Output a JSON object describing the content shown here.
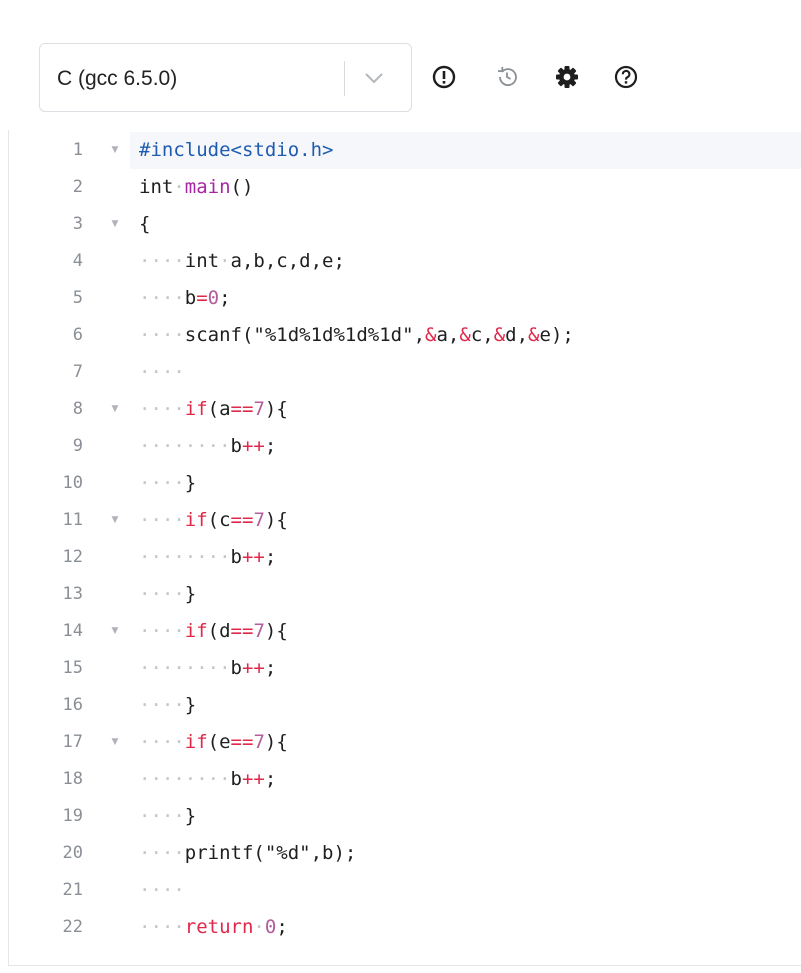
{
  "toolbar": {
    "language": "C (gcc 6.5.0)",
    "icons": [
      "info-icon",
      "history-icon",
      "settings-gear-icon",
      "help-icon"
    ]
  },
  "editor": {
    "lines": [
      {
        "num": "1",
        "fold": true,
        "active": true,
        "tokens": [
          {
            "t": "preproc",
            "v": "#include<stdio.h>"
          }
        ]
      },
      {
        "num": "2",
        "fold": false,
        "tokens": [
          {
            "t": "type",
            "v": "int"
          },
          {
            "t": "ws",
            "v": "·"
          },
          {
            "t": "func",
            "v": "main"
          },
          {
            "t": "plain",
            "v": "()"
          }
        ]
      },
      {
        "num": "3",
        "fold": true,
        "tokens": [
          {
            "t": "plain",
            "v": "{"
          }
        ]
      },
      {
        "num": "4",
        "fold": false,
        "tokens": [
          {
            "t": "ws",
            "v": "····"
          },
          {
            "t": "type",
            "v": "int"
          },
          {
            "t": "ws",
            "v": "·"
          },
          {
            "t": "plain",
            "v": "a,b,c,d,e;"
          }
        ]
      },
      {
        "num": "5",
        "fold": false,
        "tokens": [
          {
            "t": "ws",
            "v": "····"
          },
          {
            "t": "plain",
            "v": "b"
          },
          {
            "t": "op",
            "v": "="
          },
          {
            "t": "num",
            "v": "0"
          },
          {
            "t": "plain",
            "v": ";"
          }
        ]
      },
      {
        "num": "6",
        "fold": false,
        "tokens": [
          {
            "t": "ws",
            "v": "····"
          },
          {
            "t": "plain",
            "v": "scanf("
          },
          {
            "t": "str",
            "v": "\"%1d%1d%1d%1d\""
          },
          {
            "t": "plain",
            "v": ","
          },
          {
            "t": "op",
            "v": "&"
          },
          {
            "t": "plain",
            "v": "a,"
          },
          {
            "t": "op",
            "v": "&"
          },
          {
            "t": "plain",
            "v": "c,"
          },
          {
            "t": "op",
            "v": "&"
          },
          {
            "t": "plain",
            "v": "d,"
          },
          {
            "t": "op",
            "v": "&"
          },
          {
            "t": "plain",
            "v": "e);"
          }
        ]
      },
      {
        "num": "7",
        "fold": false,
        "tokens": [
          {
            "t": "ws",
            "v": "····"
          }
        ]
      },
      {
        "num": "8",
        "fold": true,
        "tokens": [
          {
            "t": "ws",
            "v": "····"
          },
          {
            "t": "keyword",
            "v": "if"
          },
          {
            "t": "plain",
            "v": "(a"
          },
          {
            "t": "op",
            "v": "=="
          },
          {
            "t": "num",
            "v": "7"
          },
          {
            "t": "plain",
            "v": "){"
          }
        ]
      },
      {
        "num": "9",
        "fold": false,
        "tokens": [
          {
            "t": "ws",
            "v": "········"
          },
          {
            "t": "plain",
            "v": "b"
          },
          {
            "t": "op",
            "v": "++"
          },
          {
            "t": "plain",
            "v": ";"
          }
        ]
      },
      {
        "num": "10",
        "fold": false,
        "tokens": [
          {
            "t": "ws",
            "v": "····"
          },
          {
            "t": "plain",
            "v": "}"
          }
        ]
      },
      {
        "num": "11",
        "fold": true,
        "tokens": [
          {
            "t": "ws",
            "v": "····"
          },
          {
            "t": "keyword",
            "v": "if"
          },
          {
            "t": "plain",
            "v": "(c"
          },
          {
            "t": "op",
            "v": "=="
          },
          {
            "t": "num",
            "v": "7"
          },
          {
            "t": "plain",
            "v": "){"
          }
        ]
      },
      {
        "num": "12",
        "fold": false,
        "tokens": [
          {
            "t": "ws",
            "v": "········"
          },
          {
            "t": "plain",
            "v": "b"
          },
          {
            "t": "op",
            "v": "++"
          },
          {
            "t": "plain",
            "v": ";"
          }
        ]
      },
      {
        "num": "13",
        "fold": false,
        "tokens": [
          {
            "t": "ws",
            "v": "····"
          },
          {
            "t": "plain",
            "v": "}"
          }
        ]
      },
      {
        "num": "14",
        "fold": true,
        "tokens": [
          {
            "t": "ws",
            "v": "····"
          },
          {
            "t": "keyword",
            "v": "if"
          },
          {
            "t": "plain",
            "v": "(d"
          },
          {
            "t": "op",
            "v": "=="
          },
          {
            "t": "num",
            "v": "7"
          },
          {
            "t": "plain",
            "v": "){"
          }
        ]
      },
      {
        "num": "15",
        "fold": false,
        "tokens": [
          {
            "t": "ws",
            "v": "········"
          },
          {
            "t": "plain",
            "v": "b"
          },
          {
            "t": "op",
            "v": "++"
          },
          {
            "t": "plain",
            "v": ";"
          }
        ]
      },
      {
        "num": "16",
        "fold": false,
        "tokens": [
          {
            "t": "ws",
            "v": "····"
          },
          {
            "t": "plain",
            "v": "}"
          }
        ]
      },
      {
        "num": "17",
        "fold": true,
        "tokens": [
          {
            "t": "ws",
            "v": "····"
          },
          {
            "t": "keyword",
            "v": "if"
          },
          {
            "t": "plain",
            "v": "(e"
          },
          {
            "t": "op",
            "v": "=="
          },
          {
            "t": "num",
            "v": "7"
          },
          {
            "t": "plain",
            "v": "){"
          }
        ]
      },
      {
        "num": "18",
        "fold": false,
        "tokens": [
          {
            "t": "ws",
            "v": "········"
          },
          {
            "t": "plain",
            "v": "b"
          },
          {
            "t": "op",
            "v": "++"
          },
          {
            "t": "plain",
            "v": ";"
          }
        ]
      },
      {
        "num": "19",
        "fold": false,
        "tokens": [
          {
            "t": "ws",
            "v": "····"
          },
          {
            "t": "plain",
            "v": "}"
          }
        ]
      },
      {
        "num": "20",
        "fold": false,
        "tokens": [
          {
            "t": "ws",
            "v": "····"
          },
          {
            "t": "plain",
            "v": "printf("
          },
          {
            "t": "str",
            "v": "\"%d\""
          },
          {
            "t": "plain",
            "v": ",b);"
          }
        ]
      },
      {
        "num": "21",
        "fold": false,
        "tokens": [
          {
            "t": "ws",
            "v": "····"
          }
        ]
      },
      {
        "num": "22",
        "fold": false,
        "tokens": [
          {
            "t": "ws",
            "v": "····"
          },
          {
            "t": "keyword",
            "v": "return"
          },
          {
            "t": "ws",
            "v": "·"
          },
          {
            "t": "num",
            "v": "0"
          },
          {
            "t": "plain",
            "v": ";"
          }
        ]
      }
    ]
  }
}
